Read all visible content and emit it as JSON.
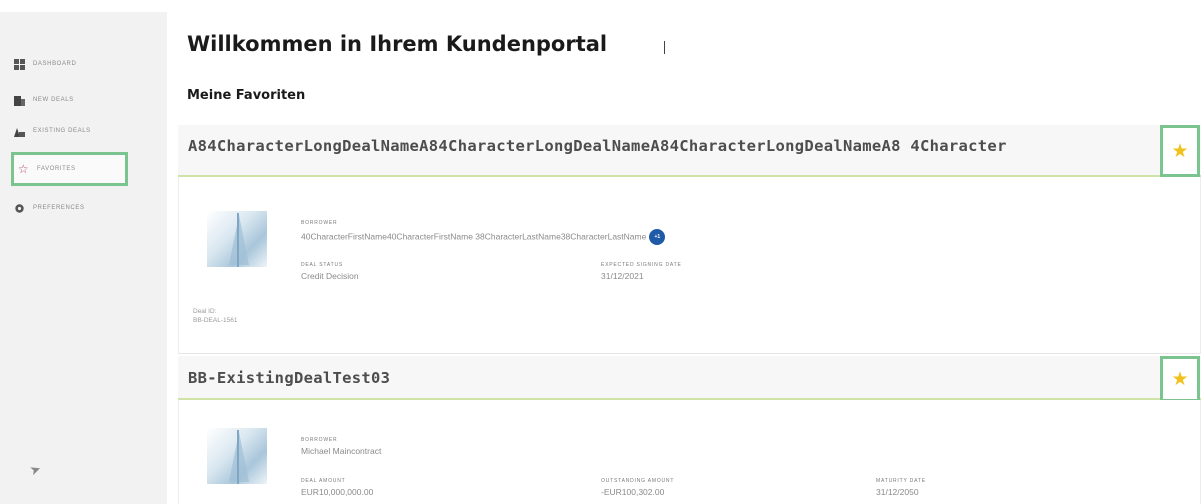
{
  "sidebar": {
    "items": [
      {
        "label": "Dashboard",
        "icon": "dashboard-icon"
      },
      {
        "label": "New Deals",
        "icon": "new-deals-icon"
      },
      {
        "label": "Existing Deals",
        "icon": "existing-deals-icon"
      },
      {
        "label": "Favorites",
        "icon": "star-outline-icon",
        "active": true
      },
      {
        "label": "Preferences",
        "icon": "gear-icon"
      }
    ]
  },
  "page": {
    "title": "Willkommen in Ihrem Kundenportal",
    "favorites_heading": "Meine Favoriten"
  },
  "deals": [
    {
      "name": "A84CharacterLongDealNameA84CharacterLongDealNameA84CharacterLongDealNameA8 4Character",
      "favorite": true,
      "borrower_label": "Borrower",
      "borrower": "40CharacterFirstName40CharacterFirstName 38CharacterLastName38CharacterLastName",
      "borrower_badge": "+1",
      "status_label": "Deal Status",
      "status": "Credit Decision",
      "signing_label": "Expected Signing Date",
      "signing_date": "31/12/2021",
      "deal_id_label": "Deal ID:",
      "deal_id": "BB-DEAL-1561"
    },
    {
      "name": "BB-ExistingDealTest03",
      "favorite": true,
      "borrower_label": "Borrower",
      "borrower": "Michael Maincontract",
      "amount_label": "Deal Amount",
      "amount": "EUR10,000,000.00",
      "outstanding_label": "Outstanding Amount",
      "outstanding": "-EUR100,302.00",
      "maturity_label": "Maturity Date",
      "maturity": "31/12/2050"
    }
  ],
  "colors": {
    "highlight_border": "#7bc48f",
    "star": "#f0c21b",
    "header_underline": "#cfe3a6",
    "badge": "#1f5aa8"
  }
}
